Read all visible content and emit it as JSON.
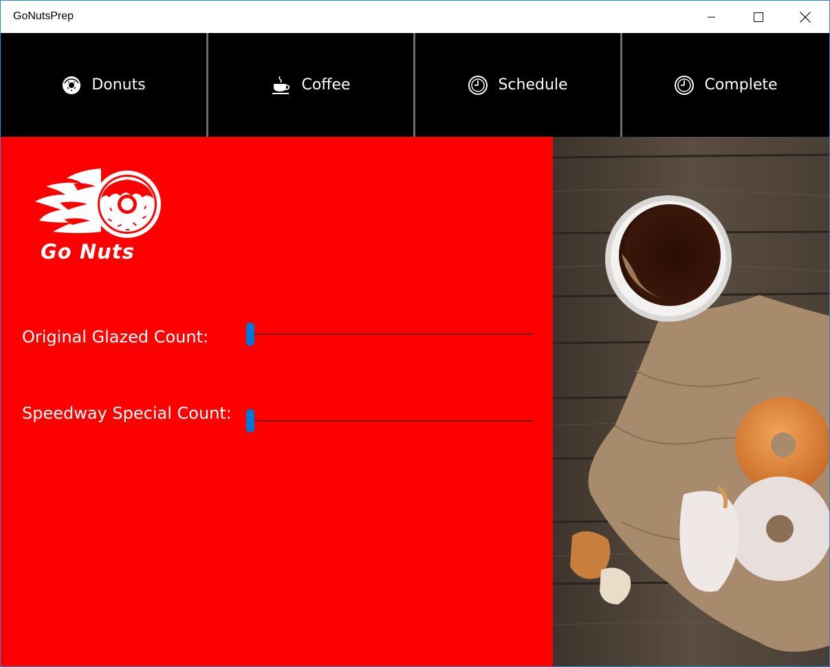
{
  "window": {
    "title": "GoNutsPrep"
  },
  "nav": {
    "items": [
      {
        "label": "Donuts",
        "icon": "donut-icon"
      },
      {
        "label": "Coffee",
        "icon": "coffee-icon"
      },
      {
        "label": "Schedule",
        "icon": "clock-icon"
      },
      {
        "label": "Complete",
        "icon": "clock-icon"
      }
    ]
  },
  "logo": {
    "text": "Go Nuts"
  },
  "form": {
    "original_glazed_label": "Original Glazed Count:",
    "original_glazed_value": 0,
    "speedway_special_label": "Speedway Special Count:",
    "speedway_special_value": 0
  },
  "colors": {
    "panel_bg": "#ff0000",
    "nav_bg": "#000000",
    "accent": "#0078d7"
  }
}
